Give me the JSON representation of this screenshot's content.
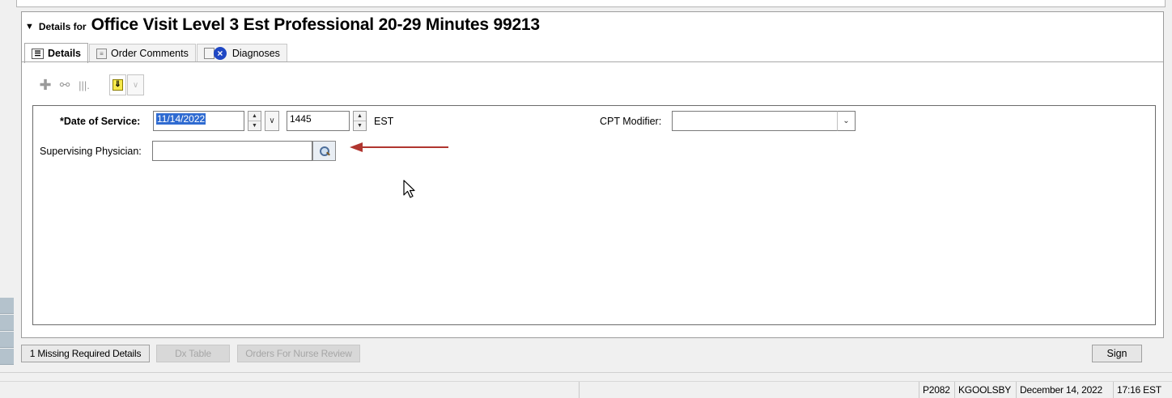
{
  "header": {
    "prefix": "Details for",
    "title": "Office Visit Level 3 Est Professional 20-29 Minutes 99213"
  },
  "tabs": [
    {
      "label": "Details",
      "icon": "details-icon",
      "active": true
    },
    {
      "label": "Order Comments",
      "icon": "order-comments-icon",
      "active": false
    },
    {
      "label": "Diagnoses",
      "icon": "diagnoses-icon",
      "active": false
    }
  ],
  "toolbar": {
    "icons": [
      "add-icon",
      "medication-icon",
      "chart-icon",
      "move-down-icon",
      "expand-all-icon"
    ]
  },
  "form": {
    "date_of_service": {
      "label": "*Date of Service:",
      "value": "11/14/2022"
    },
    "time": {
      "value": "1445",
      "zone": "EST"
    },
    "cpt_modifier": {
      "label": "CPT Modifier:",
      "value": ""
    },
    "supervising_physician": {
      "label": "Supervising Physician:",
      "value": ""
    }
  },
  "actions": {
    "missing": "1 Missing Required Details",
    "dx_table": "Dx Table",
    "orders_review": "Orders For Nurse Review",
    "sign": "Sign"
  },
  "status_bar": {
    "code": "P2082",
    "user": "KGOOLSBY",
    "date": "December 14, 2022",
    "time": "17:16 EST"
  },
  "colors": {
    "selection": "#2f6bd1",
    "arrow": "#b0352f"
  }
}
